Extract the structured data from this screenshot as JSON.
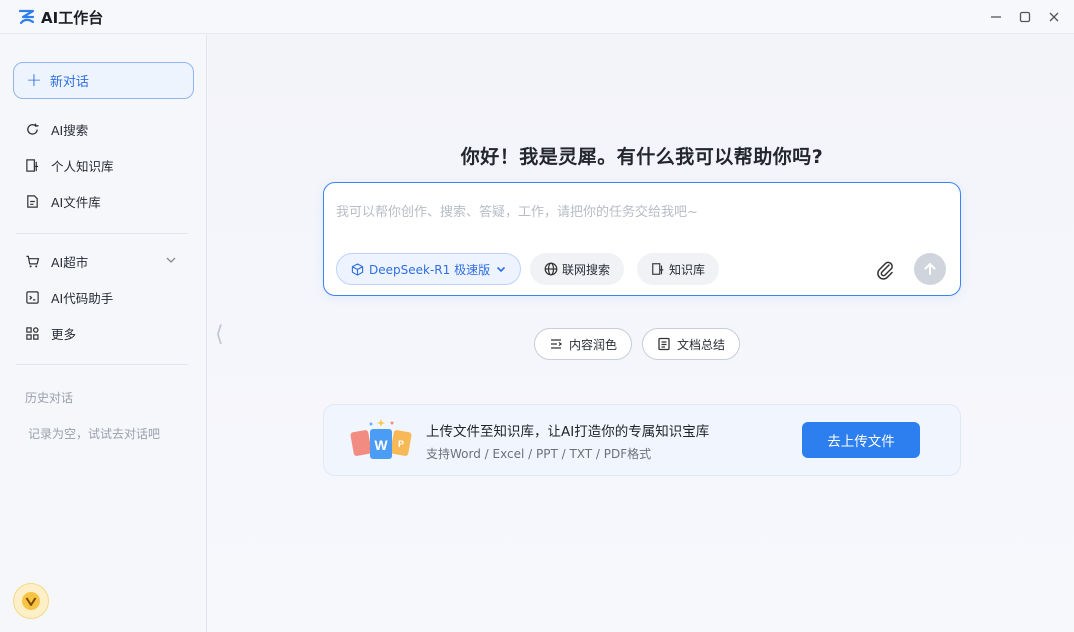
{
  "app": {
    "title": "AI工作台"
  },
  "sidebar": {
    "new_chat_label": "新对话",
    "items": [
      {
        "label": "AI搜索",
        "icon": "refresh-search-icon"
      },
      {
        "label": "个人知识库",
        "icon": "knowledge-base-icon"
      },
      {
        "label": "AI文件库",
        "icon": "file-library-icon"
      },
      {
        "label": "AI超市",
        "icon": "cart-icon",
        "expandable": true
      },
      {
        "label": "AI代码助手",
        "icon": "code-icon"
      },
      {
        "label": "更多",
        "icon": "grid-icon"
      }
    ],
    "history_title": "历史对话",
    "history_empty": "记录为空，试试去对话吧"
  },
  "main": {
    "greeting": "你好！我是灵犀。有什么我可以帮助你吗?",
    "input_placeholder": "我可以帮你创作、搜索、答疑，工作，请把你的任务交给我吧~",
    "model_label": "DeepSeek-R1 极速版",
    "web_search_label": "联网搜索",
    "knowledge_label": "知识库",
    "quick_actions": [
      "内容润色",
      "文档总结"
    ],
    "upload_card": {
      "title": "上传文件至知识库，让AI打造你的专属知识宝库",
      "subtitle": "支持Word / Excel / PPT / TXT / PDF格式",
      "button": "去上传文件",
      "art_letters": [
        "W",
        "P"
      ]
    }
  },
  "colors": {
    "accent": "#2d7ff0",
    "accent_light": "#eef4ff",
    "border_accent": "#3b82f6"
  }
}
